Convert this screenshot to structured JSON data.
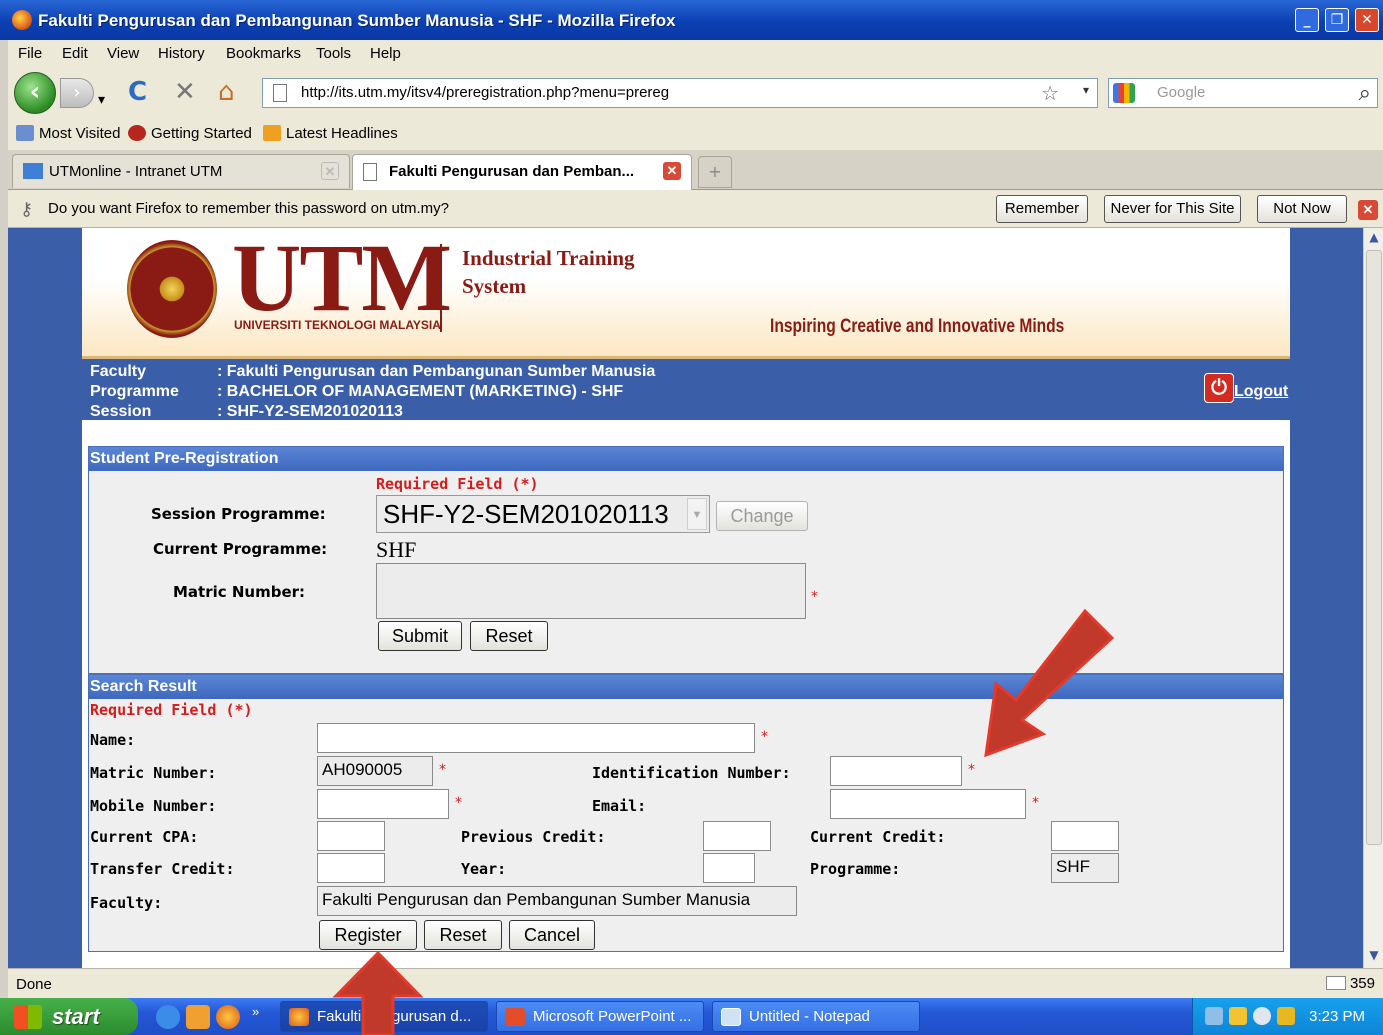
{
  "window": {
    "title": "Fakulti Pengurusan dan Pembangunan Sumber Manusia - SHF - Mozilla Firefox",
    "minimize_glyph": "_",
    "restore_glyph": "❐",
    "close_glyph": "✕"
  },
  "menu": [
    "File",
    "Edit",
    "View",
    "History",
    "Bookmarks",
    "Tools",
    "Help"
  ],
  "nav": {
    "url": "http://its.utm.my/itsv4/preregistration.php?menu=prereg",
    "search_placeholder": "Google"
  },
  "bookmarks": [
    "Most Visited",
    "Getting Started",
    "Latest Headlines"
  ],
  "tabs": [
    {
      "label": "UTMonline - Intranet UTM",
      "active": false
    },
    {
      "label": "Fakulti Pengurusan dan Pemban...",
      "active": true
    }
  ],
  "password_bar": {
    "message": "Do you want Firefox to remember this password on utm.my?",
    "remember": "Remember",
    "never": "Never for This Site",
    "not_now": "Not Now"
  },
  "banner": {
    "logo_text": "UTM",
    "logo_subtitle": "UNIVERSITI TEKNOLOGI MALAYSIA",
    "system_title": "Industrial Training System",
    "tagline": "Inspiring Creative and Innovative Minds"
  },
  "info": {
    "faculty_label": "Faculty",
    "faculty_value": ": Fakulti Pengurusan dan Pembangunan Sumber Manusia",
    "programme_label": "Programme",
    "programme_value": ": BACHELOR OF MANAGEMENT (MARKETING) - SHF",
    "session_label": "Session",
    "session_value": ": SHF-Y2-SEM201020113",
    "logout": "Logout"
  },
  "prereg": {
    "header": "Student Pre-Registration",
    "required_note": "Required Field (*)",
    "session_programme_label": "Session Programme:",
    "session_programme_value": "SHF-Y2-SEM201020113",
    "change_button": "Change",
    "current_programme_label": "Current Programme:",
    "current_programme_value": "SHF",
    "matric_label": "Matric Number:",
    "matric_value": "",
    "submit_button": "Submit",
    "reset_button": "Reset"
  },
  "search_result": {
    "header": "Search Result",
    "required_note": "Required Field (*)",
    "name_label": "Name:",
    "name_value": "",
    "matric_label": "Matric Number:",
    "matric_value": "AH090005",
    "ic_label": "Identification Number:",
    "ic_value": "",
    "mobile_label": "Mobile Number:",
    "mobile_value": "",
    "email_label": "Email:",
    "email_value": "",
    "cpa_label": "Current CPA:",
    "cpa_value": "",
    "prev_credit_label": "Previous Credit:",
    "prev_credit_value": "",
    "cur_credit_label": "Current Credit:",
    "cur_credit_value": "",
    "transfer_label": "Transfer Credit:",
    "transfer_value": "",
    "year_label": "Year:",
    "year_value": "",
    "programme_label": "Programme:",
    "programme_value": "SHF",
    "faculty_label": "Faculty:",
    "faculty_value": "Fakulti Pengurusan dan Pembangunan Sumber Manusia",
    "register_button": "Register",
    "reset_button": "Reset",
    "cancel_button": "Cancel",
    "required_star": "*"
  },
  "status": {
    "text": "Done",
    "mail_count": "359"
  },
  "taskbar": {
    "start": "start",
    "tasks": [
      "Fakulti Pengurusan d...",
      "Microsoft PowerPoint ...",
      "Untitled - Notepad"
    ],
    "time": "3:23 PM"
  },
  "colors": {
    "firefox_blue": "#3b5ea8",
    "utm_maroon": "#8a1b14",
    "required_red": "#d51c1c",
    "annotation_arrow": "#c0392b"
  }
}
